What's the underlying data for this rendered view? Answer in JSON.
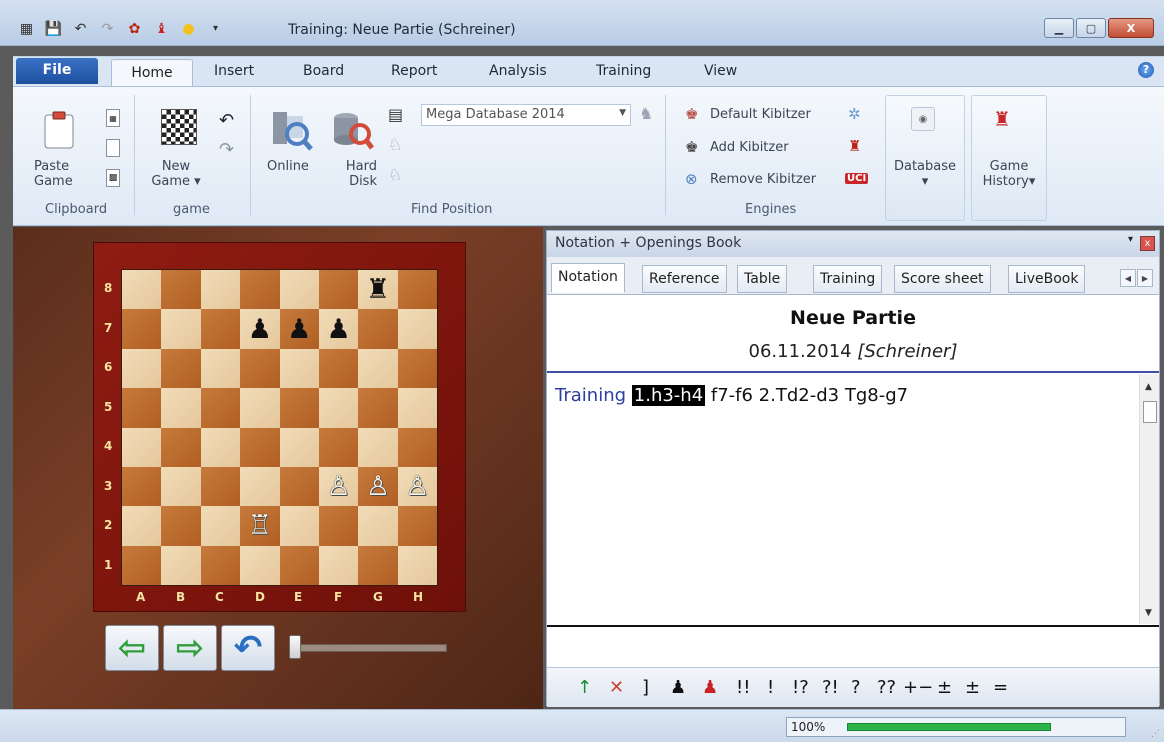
{
  "window": {
    "title": "Training: Neue Partie  (Schreiner)",
    "controls": [
      "minimize",
      "maximize",
      "close"
    ],
    "close_label": "X"
  },
  "quick_access": [
    "board-icon",
    "save-icon",
    "undo-icon",
    "redo-icon",
    "engine-icon",
    "piece-icon",
    "bulb-icon",
    "dropdown-icon"
  ],
  "ribbon": {
    "tabs": [
      "File",
      "Home",
      "Insert",
      "Board",
      "Report",
      "Analysis",
      "Training",
      "View"
    ],
    "active_tab": "Home",
    "groups": {
      "clipboard": {
        "label": "Clipboard",
        "paste_line1": "Paste",
        "paste_line2": "Game"
      },
      "game": {
        "label": "game",
        "new_line1": "New",
        "new_line2": "Game"
      },
      "find": {
        "label": "Find Position",
        "online": "Online",
        "hard_line1": "Hard",
        "hard_line2": "Disk",
        "database_value": "Mega Database 2014"
      },
      "engines": {
        "label": "Engines",
        "default_kibitzer": "Default Kibitzer",
        "add_kibitzer": "Add Kibitzer",
        "remove_kibitzer": "Remove Kibitzer",
        "uci": "UCI"
      },
      "database": {
        "label": "Database"
      },
      "history": {
        "label_line1": "Game",
        "label_line2": "History"
      }
    }
  },
  "board": {
    "files": [
      "A",
      "B",
      "C",
      "D",
      "E",
      "F",
      "G",
      "H"
    ],
    "ranks": [
      "8",
      "7",
      "6",
      "5",
      "4",
      "3",
      "2",
      "1"
    ],
    "position": [
      [
        "",
        "",
        "",
        "",
        "",
        "",
        "bR",
        ""
      ],
      [
        "",
        "",
        "",
        "bP",
        "bP",
        "bP",
        "",
        ""
      ],
      [
        "",
        "",
        "",
        "",
        "",
        "",
        "",
        ""
      ],
      [
        "",
        "",
        "",
        "",
        "",
        "",
        "",
        ""
      ],
      [
        "",
        "",
        "",
        "",
        "",
        "",
        "",
        ""
      ],
      [
        "",
        "",
        "",
        "",
        "",
        "wP",
        "wP",
        "wP"
      ],
      [
        "",
        "",
        "",
        "wR",
        "",
        "",
        "",
        ""
      ],
      [
        "",
        "",
        "",
        "",
        "",
        "",
        "",
        ""
      ]
    ]
  },
  "pane": {
    "title": "Notation + Openings Book",
    "close": "x",
    "menu": "▾",
    "tabs": [
      "Notation",
      "Reference",
      "Table",
      "Training",
      "Score sheet",
      "LiveBook"
    ],
    "active_tab": "Notation",
    "game_title": "Neue Partie",
    "game_date": "06.11.2014",
    "game_player": "[Schreiner]",
    "moves": {
      "label": "Training",
      "current": "1.h3-h4",
      "rest": "f7-f6  2.Td2-d3  Tg8-g7"
    }
  },
  "annotations": [
    "↑",
    "✕",
    "]",
    "♟",
    "♟",
    "!!",
    "!",
    "!?",
    "?!",
    "?",
    "??",
    "+−",
    "±",
    "±",
    "="
  ],
  "status": {
    "zoom": "100%",
    "zoom_level": 0.6
  }
}
